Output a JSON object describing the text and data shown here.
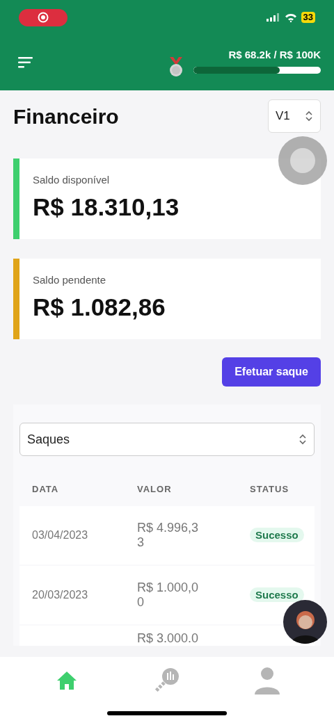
{
  "status_bar": {
    "battery": "33"
  },
  "header": {
    "goal": "R$ 68.2k / R$ 100K",
    "level": 0.68
  },
  "page": {
    "title": "Financeiro",
    "version": "V1"
  },
  "balances": [
    {
      "label": "Saldo disponível",
      "amount": "R$ 18.310,13",
      "color": "#3ecf6e"
    },
    {
      "label": "Saldo pendente",
      "amount": "R$ 1.082,86",
      "color": "#e0a419"
    }
  ],
  "withdraw_button": "Efetuar saque",
  "filter": {
    "value": "Saques"
  },
  "table": {
    "columns": [
      "DATA",
      "VALOR",
      "STATUS"
    ],
    "rows": [
      {
        "date": "03/04/2023",
        "value": "R$ 4.996,33",
        "status": "Sucesso"
      },
      {
        "date": "20/03/2023",
        "value": "R$ 1.000,00",
        "status": "Sucesso"
      },
      {
        "value": "R$ 3.000.0"
      }
    ]
  },
  "tabs": [
    {
      "kind": "home",
      "selected": true
    },
    {
      "kind": "stats",
      "selected": false
    },
    {
      "kind": "profile",
      "selected": false
    }
  ]
}
